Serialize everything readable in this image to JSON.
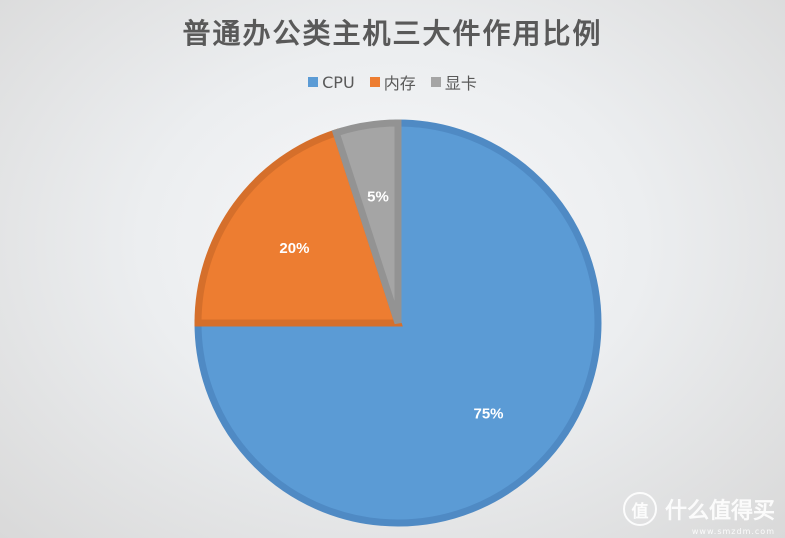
{
  "chart_data": {
    "type": "pie",
    "title": "普通办公类主机三大件作用比例",
    "categories": [
      "CPU",
      "内存",
      "显卡"
    ],
    "values": [
      75,
      20,
      5
    ],
    "labels": [
      "75%",
      "20%",
      "5%"
    ],
    "colors": [
      "#5b9bd5",
      "#ed7d31",
      "#a5a5a5"
    ],
    "border_colors": [
      "#4f8ac4",
      "#d56f2b",
      "#939393"
    ],
    "start_angle_deg": 0,
    "direction": "clockwise",
    "legend_position": "top"
  },
  "watermark": {
    "logo_glyph": "值",
    "text": "什么值得买",
    "subtext": "www.smzdm.com"
  }
}
